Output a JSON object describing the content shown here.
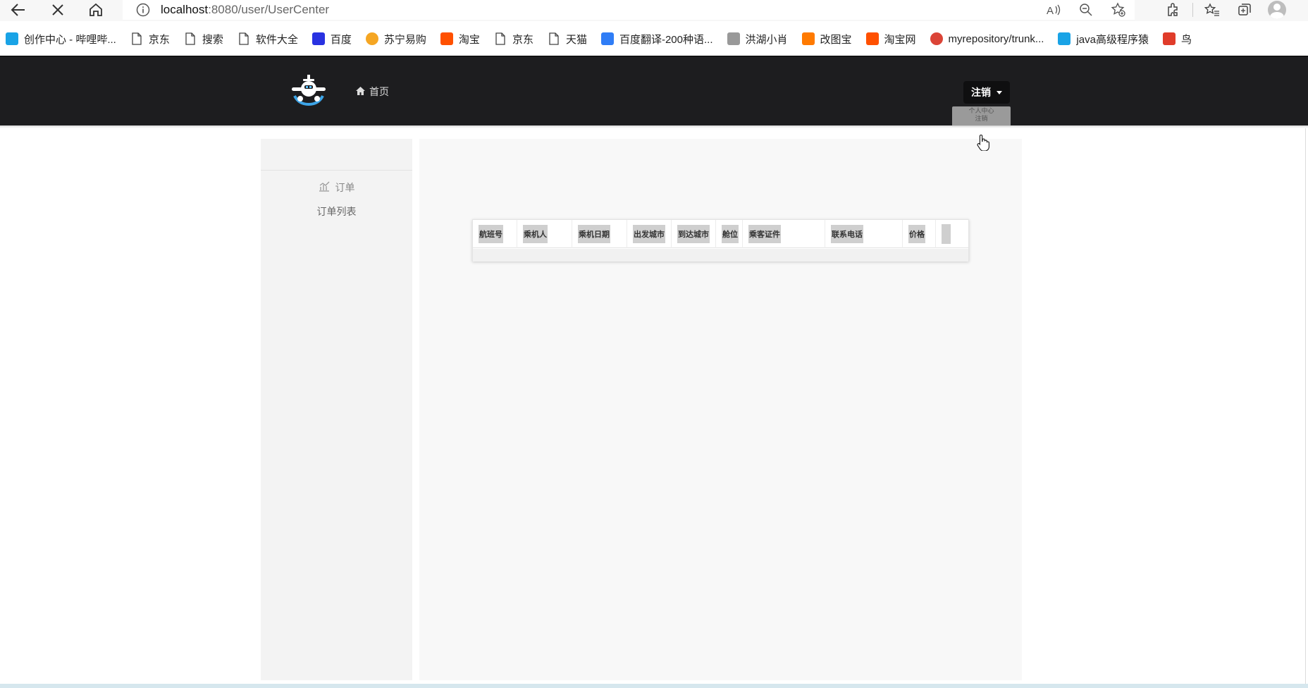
{
  "browser": {
    "url_host": "localhost",
    "url_path": ":8080/user/UserCenter",
    "toolbar_icons": [
      "back-icon",
      "close-icon",
      "home-icon",
      "info-icon",
      "read-aloud-icon",
      "zoom-out-icon",
      "favorite-add-icon",
      "extensions-icon",
      "favorites-icon",
      "collections-icon",
      "profile-icon"
    ],
    "bookmarks": [
      {
        "label": "创作中心 - 哔哩哔...",
        "icon": "bilibili-icon",
        "color": "#19a3e6"
      },
      {
        "label": "京东",
        "icon": "page-icon",
        "color": ""
      },
      {
        "label": "搜索",
        "icon": "page-icon",
        "color": ""
      },
      {
        "label": "软件大全",
        "icon": "page-icon",
        "color": ""
      },
      {
        "label": "百度",
        "icon": "baidu-icon",
        "color": "#2932e1"
      },
      {
        "label": "苏宁易购",
        "icon": "suning-icon",
        "color": "#f5a623"
      },
      {
        "label": "淘宝",
        "icon": "taobao-icon",
        "color": "#ff5000"
      },
      {
        "label": "京东",
        "icon": "page-icon",
        "color": ""
      },
      {
        "label": "天猫",
        "icon": "page-icon",
        "color": ""
      },
      {
        "label": "百度翻译-200种语...",
        "icon": "baidu-translate-icon",
        "color": "#2f7df6"
      },
      {
        "label": "洪湖小肖",
        "icon": "bird-icon",
        "color": "#999999"
      },
      {
        "label": "改图宝",
        "icon": "gaitubao-icon",
        "color": "#ff7a00"
      },
      {
        "label": "淘宝网",
        "icon": "taobao-icon",
        "color": "#ff5000"
      },
      {
        "label": "myrepository/trunk...",
        "icon": "chrome-icon",
        "color": "#db4437"
      },
      {
        "label": "java高级程序猿",
        "icon": "bilibili-icon",
        "color": "#19a3e6"
      },
      {
        "label": "鸟",
        "icon": "bird-red-icon",
        "color": "#e03c2a"
      }
    ]
  },
  "navbar": {
    "home_label": "首页",
    "logout_label": "注销",
    "dropdown_items": [
      "个人中心",
      "注销"
    ]
  },
  "sidebar": {
    "group_label": "订单",
    "items": [
      {
        "label": "订单列表"
      }
    ]
  },
  "table": {
    "columns": [
      "航班号",
      "乘机人",
      "乘机日期",
      "出发城市",
      "到达城市",
      "舱位",
      "乘客证件",
      "联系电话",
      "价格",
      ""
    ]
  },
  "colors": {
    "navbar_bg": "#1d1d1f",
    "sidebar_bg": "#f3f3f3",
    "content_bg": "#f8f8f8"
  }
}
